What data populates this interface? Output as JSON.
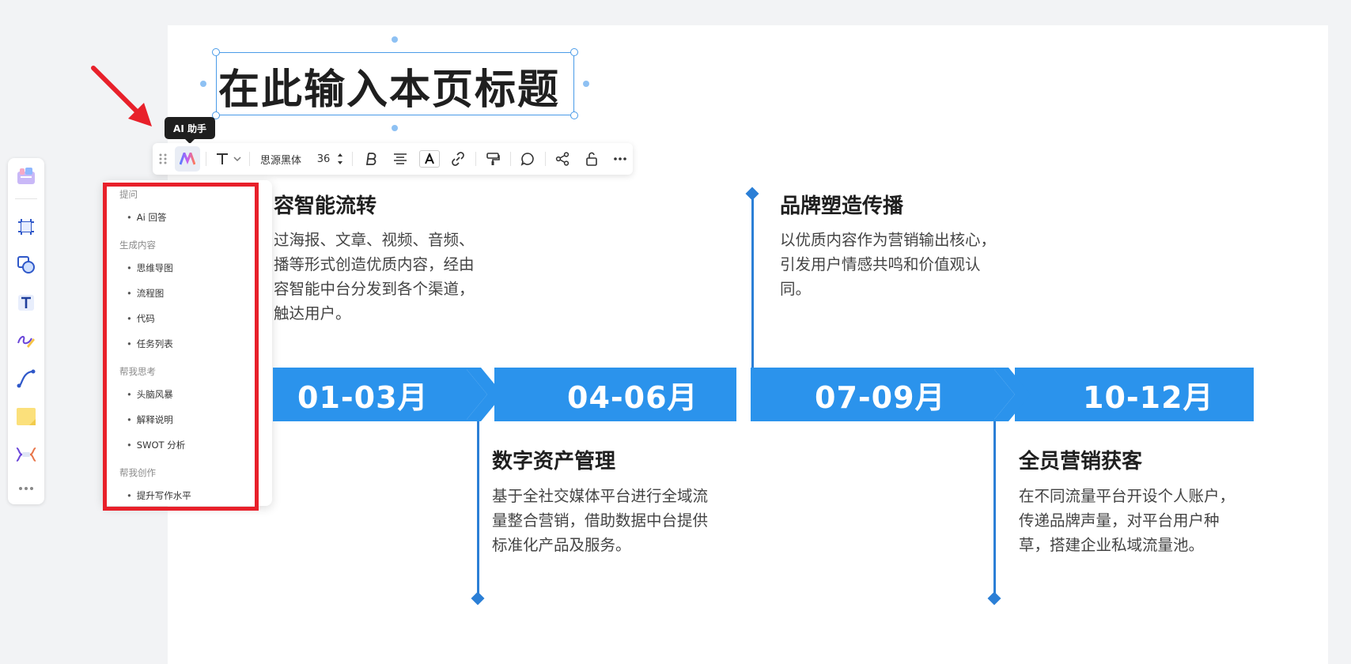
{
  "page_title": "在此输入本页标题",
  "tooltip": "AI 助手",
  "toolbar": {
    "font_family": "思源黑体",
    "font_size": "36"
  },
  "ai_menu": {
    "groups": [
      {
        "label": "提问",
        "items": [
          "Ai 回答"
        ]
      },
      {
        "label": "生成内容",
        "items": [
          "思维导图",
          "流程图",
          "代码",
          "任务列表"
        ]
      },
      {
        "label": "帮我思考",
        "items": [
          "头脑风暴",
          "解释说明",
          "SWOT 分析"
        ]
      },
      {
        "label": "帮我创作",
        "items": [
          "提升写作水平"
        ]
      }
    ]
  },
  "timeline": {
    "periods": [
      "01-03月",
      "04-06月",
      "07-09月",
      "10-12月"
    ],
    "items": [
      {
        "title": "容智能流转",
        "lines": [
          "过海报、文章、视频、音频、",
          "播等形式创造优质内容，经由",
          "容智能中台分发到各个渠道，",
          "触达用户。"
        ]
      },
      {
        "title": "数字资产管理",
        "lines": [
          "基于全社交媒体平台进行全域流",
          "量整合营销，借助数据中台提供",
          "标准化产品及服务。"
        ]
      },
      {
        "title": "品牌塑造传播",
        "lines": [
          "以优质内容作为营销输出核心，",
          "引发用户情感共鸣和价值观认",
          "同。"
        ]
      },
      {
        "title": "全员营销获客",
        "lines": [
          "在不同流量平台开设个人账户，",
          "传递品牌声量，对平台用户种",
          "草，搭建企业私域流量池。"
        ]
      }
    ]
  },
  "colors": {
    "accent": "#2b93ec",
    "highlight": "#e8202a",
    "selection": "#4a9be8"
  }
}
